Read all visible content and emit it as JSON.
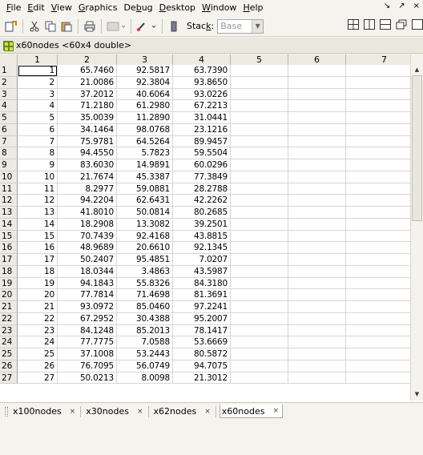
{
  "menu": {
    "items": [
      {
        "pre": "",
        "acc": "F",
        "post": "ile"
      },
      {
        "pre": "",
        "acc": "E",
        "post": "dit"
      },
      {
        "pre": "",
        "acc": "V",
        "post": "iew"
      },
      {
        "pre": "",
        "acc": "G",
        "post": "raphics"
      },
      {
        "pre": "De",
        "acc": "b",
        "post": "ug"
      },
      {
        "pre": "",
        "acc": "D",
        "post": "esktop"
      },
      {
        "pre": "",
        "acc": "W",
        "post": "indow"
      },
      {
        "pre": "",
        "acc": "H",
        "post": "elp"
      }
    ],
    "window_controls": [
      "↘",
      "↗",
      "×"
    ]
  },
  "toolbar": {
    "stack_label_pre": "Stac",
    "stack_label_acc": "k",
    "stack_label_post": ":",
    "stack_value": "Base"
  },
  "variable": {
    "title": "x60nodes <60x4 double>"
  },
  "grid": {
    "columns": [
      "1",
      "2",
      "3",
      "4",
      "5",
      "6",
      "7"
    ],
    "rows": [
      [
        "1",
        "1",
        "65.7460",
        "92.5817",
        "63.7390"
      ],
      [
        "2",
        "2",
        "21.0086",
        "92.3804",
        "93.8650"
      ],
      [
        "3",
        "3",
        "37.2012",
        "40.6064",
        "93.0226"
      ],
      [
        "4",
        "4",
        "71.2180",
        "61.2980",
        "67.2213"
      ],
      [
        "5",
        "5",
        "35.0039",
        "11.2890",
        "31.0441"
      ],
      [
        "6",
        "6",
        "34.1464",
        "98.0768",
        "23.1216"
      ],
      [
        "7",
        "7",
        "75.9781",
        "64.5264",
        "89.9457"
      ],
      [
        "8",
        "8",
        "94.4550",
        "5.7823",
        "59.5504"
      ],
      [
        "9",
        "9",
        "83.6030",
        "14.9891",
        "60.0296"
      ],
      [
        "10",
        "10",
        "21.7674",
        "45.3387",
        "77.3849"
      ],
      [
        "11",
        "11",
        "8.2977",
        "59.0881",
        "28.2788"
      ],
      [
        "12",
        "12",
        "94.2204",
        "62.6431",
        "42.2262"
      ],
      [
        "13",
        "13",
        "41.8010",
        "50.0814",
        "80.2685"
      ],
      [
        "14",
        "14",
        "18.2908",
        "13.3082",
        "39.2501"
      ],
      [
        "15",
        "15",
        "70.7439",
        "92.4168",
        "43.8815"
      ],
      [
        "16",
        "16",
        "48.9689",
        "20.6610",
        "92.1345"
      ],
      [
        "17",
        "17",
        "50.2407",
        "95.4851",
        "7.0207"
      ],
      [
        "18",
        "18",
        "18.0344",
        "3.4863",
        "43.5987"
      ],
      [
        "19",
        "19",
        "94.1843",
        "55.8326",
        "84.3180"
      ],
      [
        "20",
        "20",
        "77.7814",
        "71.4698",
        "81.3691"
      ],
      [
        "21",
        "21",
        "93.0972",
        "85.0460",
        "97.2241"
      ],
      [
        "22",
        "22",
        "67.2952",
        "30.4388",
        "95.2007"
      ],
      [
        "23",
        "23",
        "84.1248",
        "85.2013",
        "78.1417"
      ],
      [
        "24",
        "24",
        "77.7775",
        "7.0588",
        "53.6669"
      ],
      [
        "25",
        "25",
        "37.1008",
        "53.2443",
        "80.5872"
      ],
      [
        "26",
        "26",
        "76.7095",
        "56.0749",
        "94.7075"
      ],
      [
        "27",
        "27",
        "50.0213",
        "8.0098",
        "21.3012"
      ]
    ]
  },
  "tabs": [
    {
      "label": "x100nodes",
      "active": false
    },
    {
      "label": "x30nodes",
      "active": false
    },
    {
      "label": "x62nodes",
      "active": false
    },
    {
      "label": "x60nodes",
      "active": true
    }
  ],
  "tab_close_glyph": "×"
}
